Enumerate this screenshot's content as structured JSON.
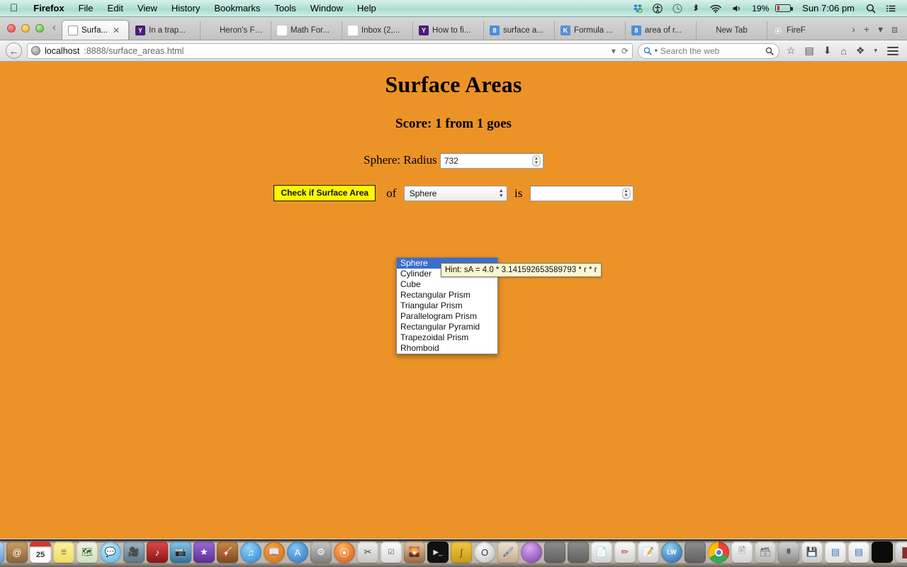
{
  "menubar": {
    "apple": "apple-logo",
    "items": [
      "Firefox",
      "File",
      "Edit",
      "View",
      "History",
      "Bookmarks",
      "Tools",
      "Window",
      "Help"
    ],
    "battery_percent": "19%",
    "clock": "Sun 7:06 pm",
    "status_icons": [
      "dropbox-icon",
      "accessibility-icon",
      "time-machine-icon",
      "bluetooth-icon",
      "wifi-icon",
      "volume-icon"
    ],
    "right_icons": [
      "spotlight-search-icon",
      "notification-center-icon"
    ]
  },
  "browser": {
    "tabs": [
      {
        "label": "Surfa...",
        "favicon": "globe-icon",
        "active": true,
        "closable": true
      },
      {
        "label": "In a trap...",
        "favicon": "yahoo-icon",
        "active": false,
        "closable": false
      },
      {
        "label": "Heron's For...",
        "favicon": "blank-icon",
        "active": false,
        "closable": false
      },
      {
        "label": "Math For...",
        "favicon": "math-forum-icon",
        "active": false,
        "closable": false
      },
      {
        "label": "Inbox (2,...",
        "favicon": "gmail-icon",
        "active": false,
        "closable": false
      },
      {
        "label": "How to fi...",
        "favicon": "yahoo-icon",
        "active": false,
        "closable": false
      },
      {
        "label": "surface a...",
        "favicon": "google-icon",
        "active": false,
        "closable": false
      },
      {
        "label": "Formula ...",
        "favicon": "khan-academy-icon",
        "active": false,
        "closable": false
      },
      {
        "label": "area of r...",
        "favicon": "google-icon",
        "active": false,
        "closable": false
      },
      {
        "label": "New Tab",
        "favicon": "blank-icon",
        "active": false,
        "closable": false
      },
      {
        "label": "FireF",
        "favicon": "firefox-icon",
        "active": false,
        "closable": false
      }
    ],
    "tabstrip_buttons": [
      "scroll-right-icon",
      "new-tab-icon",
      "tab-list-icon",
      "fullscreen-icon"
    ],
    "url_host": "localhost",
    "url_rest": ":8888/surface_areas.html",
    "search_placeholder": "Search the web",
    "nav_icons": [
      "back-icon",
      "bookmark-star-icon",
      "reader-icon",
      "downloads-icon",
      "home-icon",
      "sync-icon",
      "menu-icon"
    ]
  },
  "page": {
    "title": "Surface Areas",
    "score": "Score: 1 from 1 goes",
    "radius_label": "Sphere: Radius",
    "radius_value": "732",
    "check_button": "Check if Surface Area",
    "word_of": "of",
    "word_is": "is",
    "shape_selected": "Sphere",
    "answer_value": "",
    "shape_options": [
      "Sphere",
      "Cylinder",
      "Cube",
      "Rectangular Prism",
      "Triangular Prism",
      "Parallelogram Prism",
      "Rectangular Pyramid",
      "Trapezoidal Prism",
      "Rhomboid"
    ],
    "tooltip": "Hint: sA = 4.0 * 3.141592653589793 * r * r",
    "background_color": "#ec9327",
    "button_color": "#fff700",
    "highlight_color": "#3b6ecc"
  },
  "dock": {
    "items": [
      "finder-icon",
      "launchpad-icon",
      "safari-icon",
      "mail-icon",
      "contacts-icon",
      "calendar-icon",
      "notes-icon",
      "maps-icon",
      "messages-icon",
      "facetime-icon",
      "itunes-store-icon",
      "photo-booth-icon",
      "imovie-icon",
      "garageband-icon",
      "itunes-icon",
      "ibooks-icon",
      "app-store-icon",
      "system-preferences-icon",
      "firefox-icon",
      "inkscape-icon",
      "reminders-icon",
      "iphoto-icon",
      "terminal-icon",
      "wolfram-icon",
      "opera-icon",
      "paintbrush-icon",
      "purple-orb-icon",
      "window-1-icon",
      "window-2-icon",
      "document-1-icon",
      "document-2-icon",
      "document-3-icon",
      "livewires-icon",
      "window-3-icon",
      "chrome-icon",
      "document-4-icon",
      "document-5-icon",
      "calculator-icon",
      "drive-icon",
      "window-4-icon",
      "window-5-icon",
      "black-window-icon",
      "file-1-icon",
      "file-2-icon",
      "file-3-icon",
      "trash-icon"
    ]
  }
}
